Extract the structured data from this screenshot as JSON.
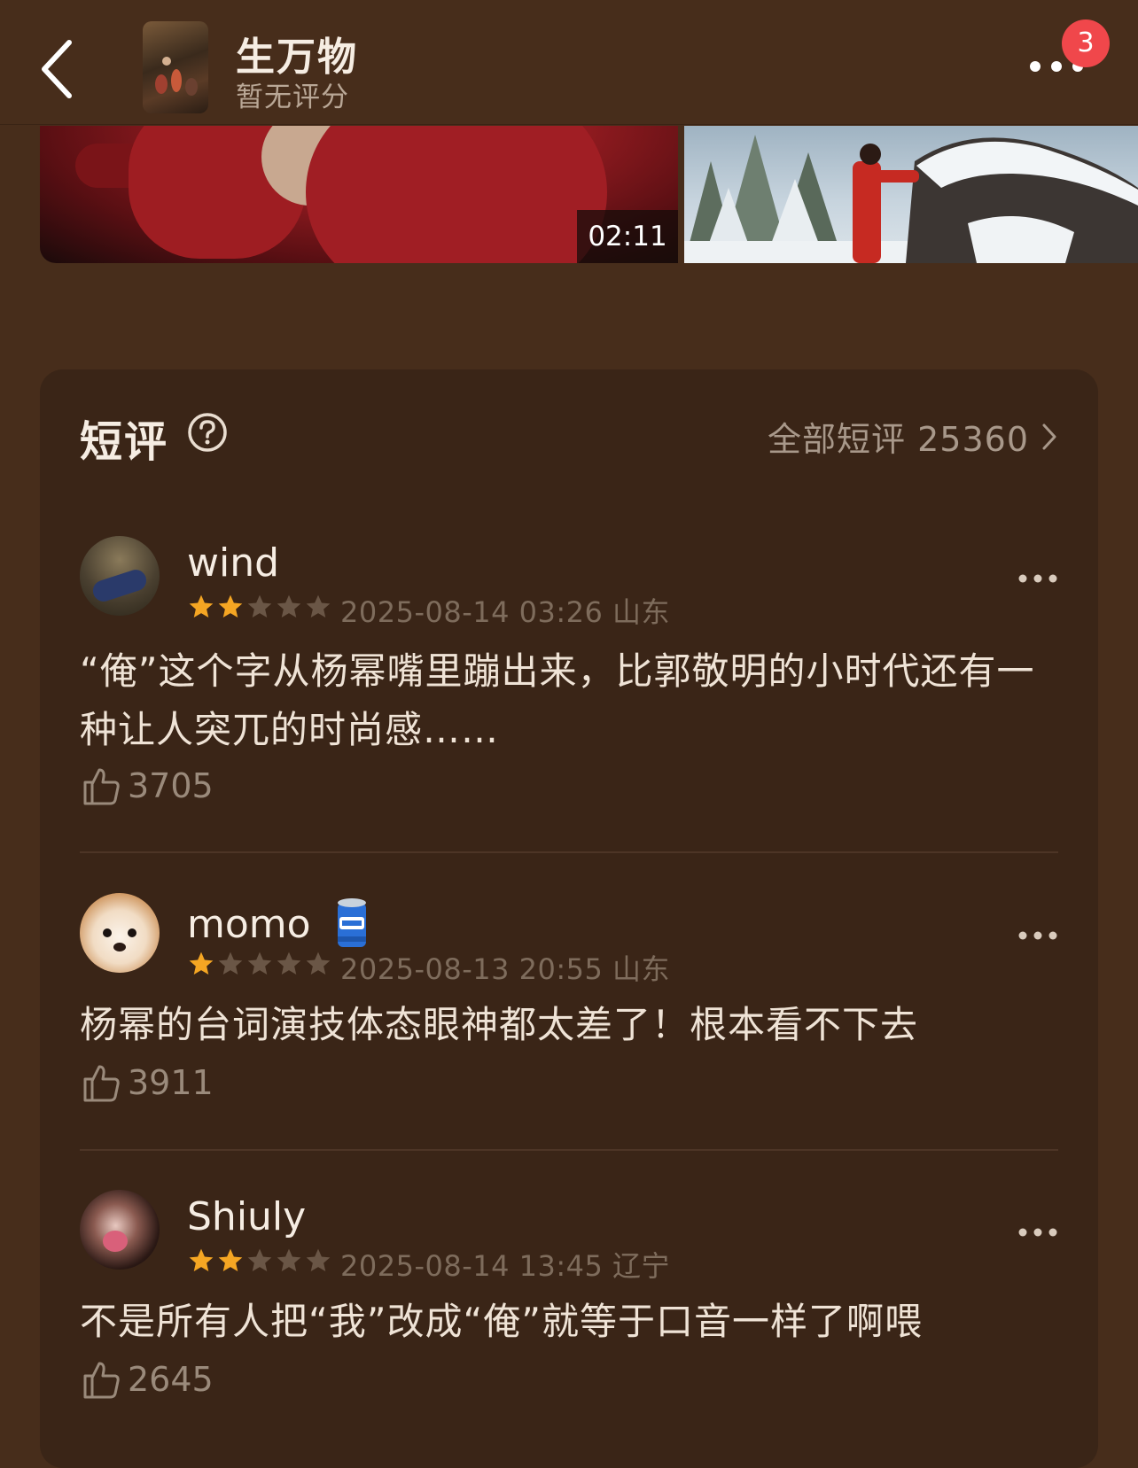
{
  "header": {
    "title": "生万物",
    "rating_text": "暂无评分",
    "badge_count": "3"
  },
  "media": {
    "video_duration": "02:11"
  },
  "short_reviews": {
    "section_title": "短评",
    "all_link": "全部短评 25360",
    "items": [
      {
        "username": "wind",
        "stars": 2,
        "meta": "2025-08-14 03:26 山东",
        "text": "“俺”这个字从杨幂嘴里蹦出来，比郭敬明的小时代还有一种让人突兀的时尚感……",
        "likes": "3705"
      },
      {
        "username": "momo",
        "stars": 1,
        "meta": "2025-08-13 20:55 山东",
        "text": "杨幂的台词演技体态眼神都太差了！根本看不下去",
        "likes": "3911"
      },
      {
        "username": "Shiuly",
        "stars": 2,
        "meta": "2025-08-14 13:45 辽宁",
        "text": "不是所有人把“我”改成“俺”就等于口音一样了啊喂",
        "likes": "2645"
      }
    ]
  },
  "colors": {
    "background": "#472d1b",
    "card": "#3a2517",
    "star_active": "#f5a623",
    "star_inactive": "#6a5646",
    "badge": "#f0474b"
  },
  "icons": {
    "back": "chevron-left-icon",
    "more": "more-dots-icon",
    "help": "question-circle-icon",
    "arrow": "chevron-right-icon",
    "like": "thumbs-up-icon",
    "user_badge": "beer-can-icon"
  }
}
